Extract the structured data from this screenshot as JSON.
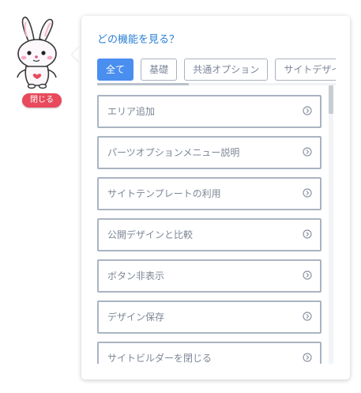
{
  "mascot": {
    "icon": "rabbit-mascot-icon",
    "close_label": "閉じる"
  },
  "panel": {
    "title": "どの機能を見る？",
    "tabs": [
      {
        "label": "全て",
        "active": true
      },
      {
        "label": "基礎",
        "active": false
      },
      {
        "label": "共通オプション",
        "active": false
      },
      {
        "label": "サイトデザイン",
        "active": false
      }
    ],
    "items": [
      {
        "label": "エリア追加"
      },
      {
        "label": "パーツオプションメニュー説明"
      },
      {
        "label": "サイトテンプレートの利用"
      },
      {
        "label": "公開デザインと比較"
      },
      {
        "label": "ボタン非表示"
      },
      {
        "label": "デザイン保存"
      },
      {
        "label": "サイトビルダーを閉じる"
      }
    ]
  },
  "colors": {
    "accent": "#4a8ef0",
    "title": "#2a7fd6",
    "close_button": "#e8495b",
    "item_border": "#aab4c2"
  }
}
